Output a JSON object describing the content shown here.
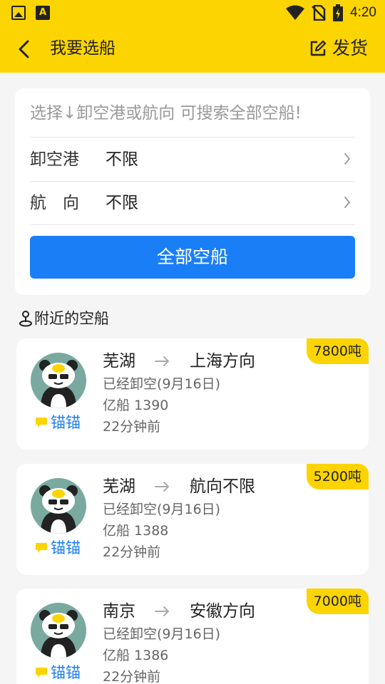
{
  "status_bar": {
    "time": "4:20"
  },
  "header": {
    "title": "我要选船",
    "action_label": "发货"
  },
  "search": {
    "hint": "选择↓卸空港或航向 可搜索全部空船!",
    "filters": [
      {
        "label": "卸空港",
        "value": "不限"
      },
      {
        "label": "航　向",
        "value": "不限"
      }
    ],
    "button_label": "全部空船"
  },
  "nearby": {
    "title": "附近的空船",
    "ships": [
      {
        "tonnage": "7800吨",
        "tag": "锚锚",
        "from": "芜湖",
        "to": "上海方向",
        "status": "已经卸空(9月16日)",
        "ship_name": "亿船 1390",
        "time_ago": "22分钟前"
      },
      {
        "tonnage": "5200吨",
        "tag": "锚锚",
        "from": "芜湖",
        "to": "航向不限",
        "status": "已经卸空(9月16日)",
        "ship_name": "亿船 1388",
        "time_ago": "22分钟前"
      },
      {
        "tonnage": "7000吨",
        "tag": "锚锚",
        "from": "南京",
        "to": "安徽方向",
        "status": "已经卸空(9月16日)",
        "ship_name": "亿船 1386",
        "time_ago": "22分钟前"
      }
    ]
  },
  "colors": {
    "brand_yellow": "#fcd400",
    "accent_blue": "#1a7ef7",
    "background": "#f5f5f5"
  },
  "icons": [
    "image-icon",
    "a-notification-icon",
    "wifi-icon",
    "no-sim-icon",
    "battery-icon",
    "back-icon",
    "edit-icon",
    "chevron-right-icon",
    "joystick-icon",
    "chat-icon",
    "arrow-right-icon",
    "panda-avatar"
  ]
}
